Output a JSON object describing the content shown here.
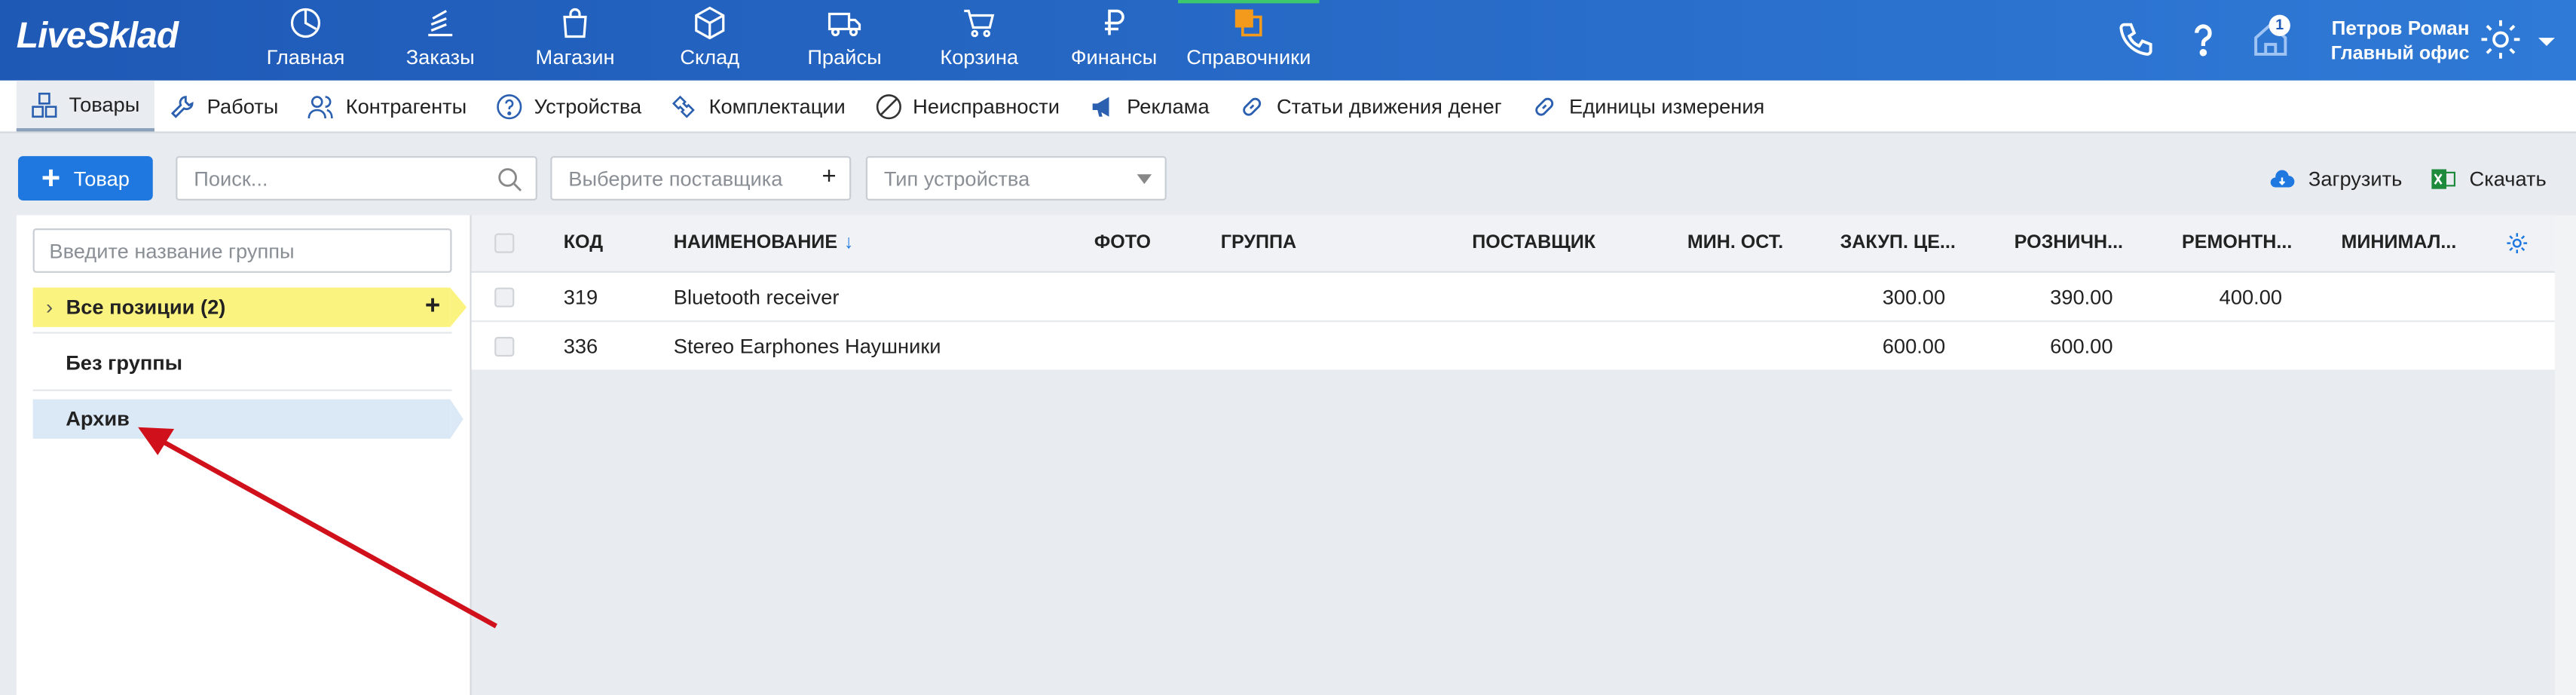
{
  "app": {
    "logo": "LiveSklad"
  },
  "nav": [
    {
      "label": "Главная",
      "icon": "dashboard-icon"
    },
    {
      "label": "Заказы",
      "icon": "orders-icon"
    },
    {
      "label": "Магазин",
      "icon": "shop-bag-icon"
    },
    {
      "label": "Склад",
      "icon": "box-icon"
    },
    {
      "label": "Прайсы",
      "icon": "truck-icon"
    },
    {
      "label": "Корзина",
      "icon": "cart-icon"
    },
    {
      "label": "Финансы",
      "icon": "ruble-icon"
    },
    {
      "label": "Справочники",
      "icon": "directory-icon"
    }
  ],
  "header": {
    "notifications_count": "1",
    "user_name": "Петров Роман",
    "user_office": "Главный офис"
  },
  "subnav": [
    {
      "label": "Товары",
      "icon": "cubes-icon"
    },
    {
      "label": "Работы",
      "icon": "wrench-icon"
    },
    {
      "label": "Контрагенты",
      "icon": "contacts-icon"
    },
    {
      "label": "Устройства",
      "icon": "question-circle-icon"
    },
    {
      "label": "Комплектации",
      "icon": "puzzle-icon"
    },
    {
      "label": "Неисправности",
      "icon": "broken-icon"
    },
    {
      "label": "Реклама",
      "icon": "megaphone-icon"
    },
    {
      "label": "Статьи движения денег",
      "icon": "link-icon"
    },
    {
      "label": "Единицы измерения",
      "icon": "link-icon"
    }
  ],
  "toolbar": {
    "add_label": "Товар",
    "search_placeholder": "Поиск...",
    "supplier_placeholder": "Выберите поставщика",
    "device_type_placeholder": "Тип устройства",
    "upload_label": "Загрузить",
    "download_label": "Скачать"
  },
  "groups": {
    "search_placeholder": "Введите название группы",
    "all_label": "Все позиции (2)",
    "none_label": "Без группы",
    "archive_label": "Архив"
  },
  "table": {
    "columns": [
      "КОД",
      "НАИМЕНОВАНИЕ",
      "ФОТО",
      "ГРУППА",
      "ПОСТАВЩИК",
      "МИН. ОСТ.",
      "ЗАКУП. ЦЕ...",
      "РОЗНИЧН...",
      "РЕМОНТН...",
      "МИНИМАЛ..."
    ],
    "rows": [
      {
        "code": "319",
        "name": "Bluetooth receiver",
        "purchase": "300.00",
        "retail": "390.00",
        "repair": "400.00"
      },
      {
        "code": "336",
        "name": "Stereo Earphones Наушники",
        "purchase": "600.00",
        "retail": "600.00",
        "repair": ""
      }
    ]
  },
  "colors": {
    "header_start": "#1f59b6",
    "header_end": "#2f7ad6",
    "accent": "#1e78e0",
    "highlight": "#fbf37f",
    "annotation_arrow": "#d0101a"
  }
}
